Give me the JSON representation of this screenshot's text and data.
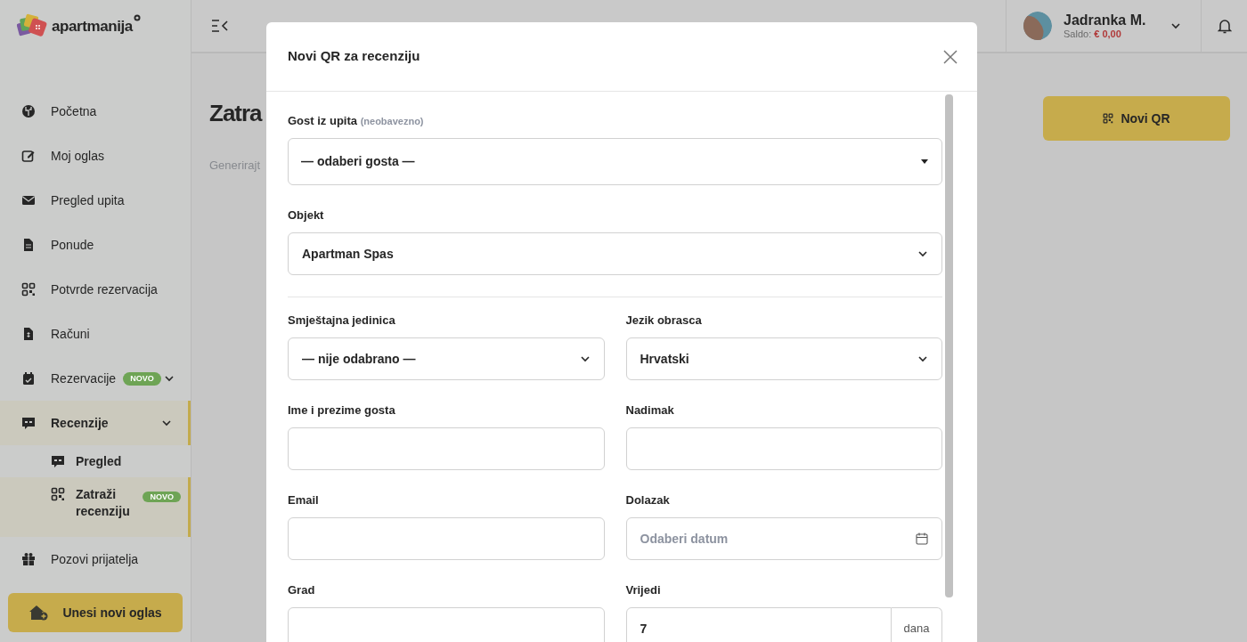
{
  "logo": {
    "text": "apartmanija"
  },
  "sidebar": {
    "items": [
      {
        "kind": "link",
        "label": "Početna",
        "selected": false
      },
      {
        "kind": "link",
        "label": "Moj oglas",
        "selected": false
      },
      {
        "kind": "link",
        "label": "Pregled upita",
        "selected": false
      },
      {
        "kind": "link",
        "label": "Ponude",
        "selected": false
      },
      {
        "kind": "link",
        "label": "Potvrde rezervacija",
        "selected": false
      },
      {
        "kind": "link",
        "label": "Računi",
        "selected": false
      },
      {
        "kind": "group",
        "label": "Rezervacije",
        "selected": false,
        "badge": "NOVO"
      },
      {
        "kind": "group",
        "label": "Recenzije",
        "selected": true,
        "expanded": true,
        "children": [
          {
            "label": "Pregled",
            "selected": false
          },
          {
            "label": "Zatraži recenziju",
            "selected": true,
            "badge": "NOVO"
          }
        ]
      },
      {
        "kind": "link",
        "label": "Pozovi prijatelja",
        "selected": false
      }
    ],
    "cta": "Unesi novi oglas"
  },
  "header": {
    "user": {
      "name": "Jadranka M.",
      "balance_label": "Saldo:",
      "balance": "€ 0,00"
    }
  },
  "page": {
    "title": "Zatra",
    "subtitle": "Generirajt",
    "new_button": "Novi QR"
  },
  "modal": {
    "title": "Novi QR za recenziju",
    "guest": {
      "label": "Gost iz upita",
      "hint": "(neobavezno)",
      "value": "— odaberi gosta —"
    },
    "object": {
      "label": "Objekt",
      "value": "Apartman Spas"
    },
    "fields": [
      {
        "kind": "select",
        "label": "Smještajna jedinica",
        "value": "— nije odabrano —"
      },
      {
        "kind": "select",
        "label": "Jezik obrasca",
        "value": "Hrvatski"
      },
      {
        "kind": "text",
        "label": "Ime i prezime gosta"
      },
      {
        "kind": "text",
        "label": "Nadimak"
      },
      {
        "kind": "text",
        "label": "Email"
      },
      {
        "kind": "date",
        "label": "Dolazak",
        "placeholder": "Odaberi datum"
      },
      {
        "kind": "text",
        "label": "Grad"
      },
      {
        "kind": "suffix",
        "label": "Vrijedi",
        "value": "7",
        "suffix": "dana"
      }
    ]
  }
}
